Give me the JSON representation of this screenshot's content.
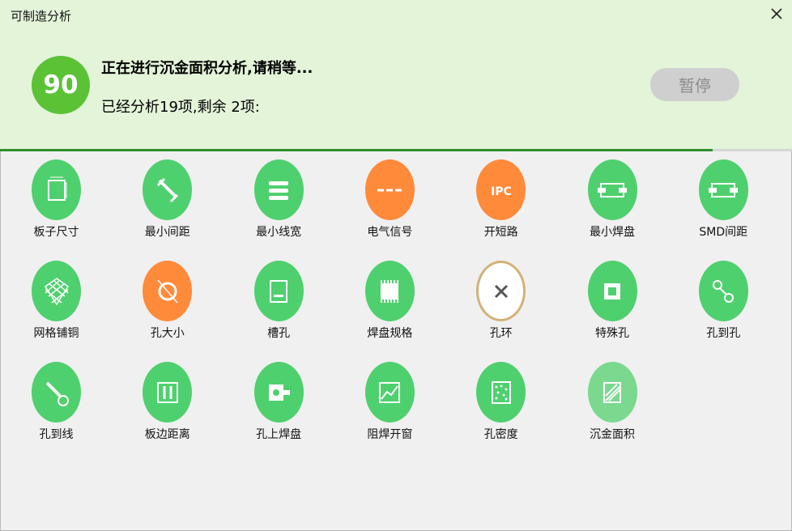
{
  "window": {
    "title": "可制造分析"
  },
  "header": {
    "score": "90",
    "status": "正在进行沉金面积分析,请稍等...",
    "progress_text": "已经分析19项,剩余 2项:",
    "pause_label": "暂停",
    "progress": 0.9
  },
  "colors": {
    "header_bg": "#e3f4d9",
    "score_bg": "#5bc236",
    "icon_green": "#4fd06e",
    "icon_orange": "#ff8a3a",
    "progress_bar": "#2f8f2a"
  },
  "items": [
    {
      "label": "板子尺寸",
      "icon": "board-size-icon",
      "status": "green"
    },
    {
      "label": "最小间距",
      "icon": "min-spacing-icon",
      "status": "green"
    },
    {
      "label": "最小线宽",
      "icon": "min-trace-width-icon",
      "status": "green"
    },
    {
      "label": "电气信号",
      "icon": "electrical-signal-icon",
      "status": "orange"
    },
    {
      "label": "开短路",
      "icon": "ipc-open-short-icon",
      "status": "orange"
    },
    {
      "label": "最小焊盘",
      "icon": "min-pad-icon",
      "status": "green"
    },
    {
      "label": "SMD间距",
      "icon": "smd-spacing-icon",
      "status": "green"
    },
    {
      "label": "网格铺铜",
      "icon": "mesh-copper-icon",
      "status": "green"
    },
    {
      "label": "孔大小",
      "icon": "hole-size-icon",
      "status": "orange"
    },
    {
      "label": "槽孔",
      "icon": "slot-hole-icon",
      "status": "green"
    },
    {
      "label": "焊盘规格",
      "icon": "pad-spec-icon",
      "status": "green"
    },
    {
      "label": "孔环",
      "icon": "annular-ring-icon",
      "status": "ring"
    },
    {
      "label": "特殊孔",
      "icon": "special-hole-icon",
      "status": "green"
    },
    {
      "label": "孔到孔",
      "icon": "hole-to-hole-icon",
      "status": "green"
    },
    {
      "label": "孔到线",
      "icon": "hole-to-trace-icon",
      "status": "green"
    },
    {
      "label": "板边距离",
      "icon": "board-edge-distance-icon",
      "status": "green"
    },
    {
      "label": "孔上焊盘",
      "icon": "pad-on-hole-icon",
      "status": "green"
    },
    {
      "label": "阻焊开窗",
      "icon": "solder-mask-opening-icon",
      "status": "green"
    },
    {
      "label": "孔密度",
      "icon": "hole-density-icon",
      "status": "green"
    },
    {
      "label": "沉金面积",
      "icon": "gold-area-icon",
      "status": "active"
    }
  ]
}
